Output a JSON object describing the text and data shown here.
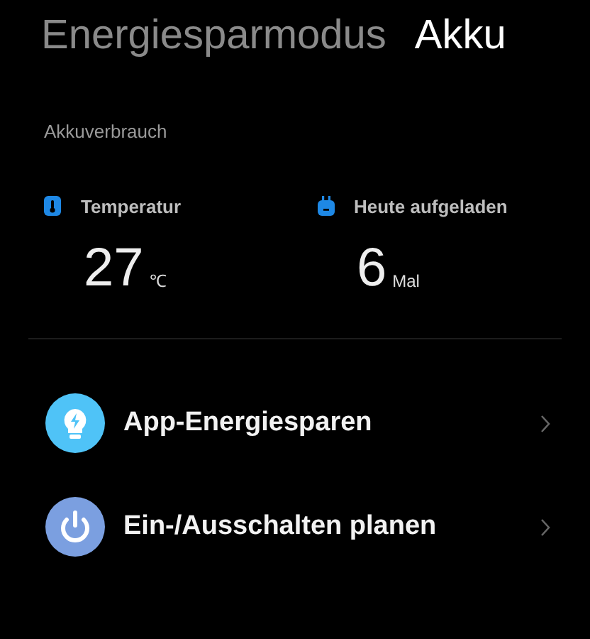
{
  "tabs": [
    {
      "label": "Energiesparmodus",
      "selected": false
    },
    {
      "label": "Akku",
      "selected": true
    }
  ],
  "section_title": "Akkuverbrauch",
  "stats": [
    {
      "kind": "temperature",
      "label": "Temperatur",
      "value": "27",
      "unit": "℃"
    },
    {
      "kind": "charges",
      "label": "Heute aufgeladen",
      "value": "6",
      "unit": "Mal"
    }
  ],
  "items": [
    {
      "kind": "bulb",
      "label": "App-Energiesparen",
      "color": "#4fc3f7"
    },
    {
      "kind": "power",
      "label": "Ein-/Ausschalten planen",
      "color": "#7b9fe0"
    }
  ]
}
